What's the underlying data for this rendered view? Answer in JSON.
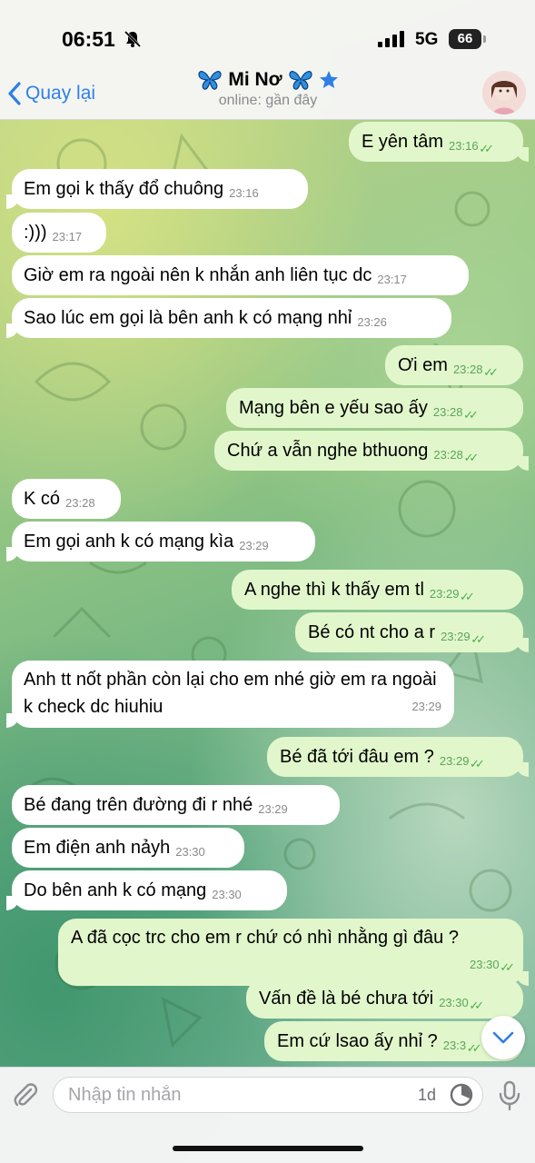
{
  "status_bar": {
    "time": "06:51",
    "network": "5G",
    "battery": "66"
  },
  "header": {
    "back_label": "Quay lại",
    "name": "Mi Nơ",
    "status": "online: gần đây"
  },
  "messages": [
    {
      "dir": "out",
      "text": "E yên tâm",
      "time": "23:16",
      "read": true
    },
    {
      "dir": "in",
      "text": "Em gọi k thấy đổ chuông",
      "time": "23:16"
    },
    {
      "dir": "in",
      "text": ":)))",
      "time": "23:17"
    },
    {
      "dir": "in",
      "text": "Giờ em ra ngoài nên k nhắn anh liên tục dc",
      "time": "23:17"
    },
    {
      "dir": "in",
      "text": "Sao lúc em gọi là bên anh k có mạng nhỉ",
      "time": "23:26"
    },
    {
      "dir": "out",
      "text": "Ơi em",
      "time": "23:28",
      "read": true
    },
    {
      "dir": "out",
      "text": "Mạng bên e yếu sao ấy",
      "time": "23:28",
      "read": true
    },
    {
      "dir": "out",
      "text": "Chứ a vẫn nghe bthuong",
      "time": "23:28",
      "read": true
    },
    {
      "dir": "in",
      "text": "K có",
      "time": "23:28"
    },
    {
      "dir": "in",
      "text": "Em gọi anh k có mạng kìa",
      "time": "23:29"
    },
    {
      "dir": "out",
      "text": "A nghe thì k thấy em tl",
      "time": "23:29",
      "read": true
    },
    {
      "dir": "out",
      "text": "Bé có nt cho a r",
      "time": "23:29",
      "read": true
    },
    {
      "dir": "in",
      "text": "Anh tt nốt phần còn lại cho em nhé giờ em ra ngoài k check dc hiuhiu",
      "time": "23:29"
    },
    {
      "dir": "out",
      "text": "Bé đã tới đâu em ?",
      "time": "23:29",
      "read": true
    },
    {
      "dir": "in",
      "text": "Bé đang trên đường đi r nhé",
      "time": "23:29"
    },
    {
      "dir": "in",
      "text": "Em điện anh nảyh",
      "time": "23:30"
    },
    {
      "dir": "in",
      "text": "Do bên anh k có mạng",
      "time": "23:30"
    },
    {
      "dir": "out",
      "text": "A đã cọc trc cho em r chứ có nhì nhằng gì đâu ?",
      "time": "23:30",
      "read": true
    },
    {
      "dir": "out",
      "text": "Vấn đề là bé chưa tới",
      "time": "23:30",
      "read": true
    },
    {
      "dir": "out",
      "text": "Em cứ lsao ấy nhỉ ?",
      "time": "23:3",
      "read": true
    }
  ],
  "composer": {
    "placeholder": "Nhập tin nhắn",
    "timer": "1d"
  },
  "colors": {
    "accent": "#2f7fe6",
    "incoming": "#ffffff",
    "outgoing": "#e1f7cb",
    "check": "#4cae4c"
  }
}
